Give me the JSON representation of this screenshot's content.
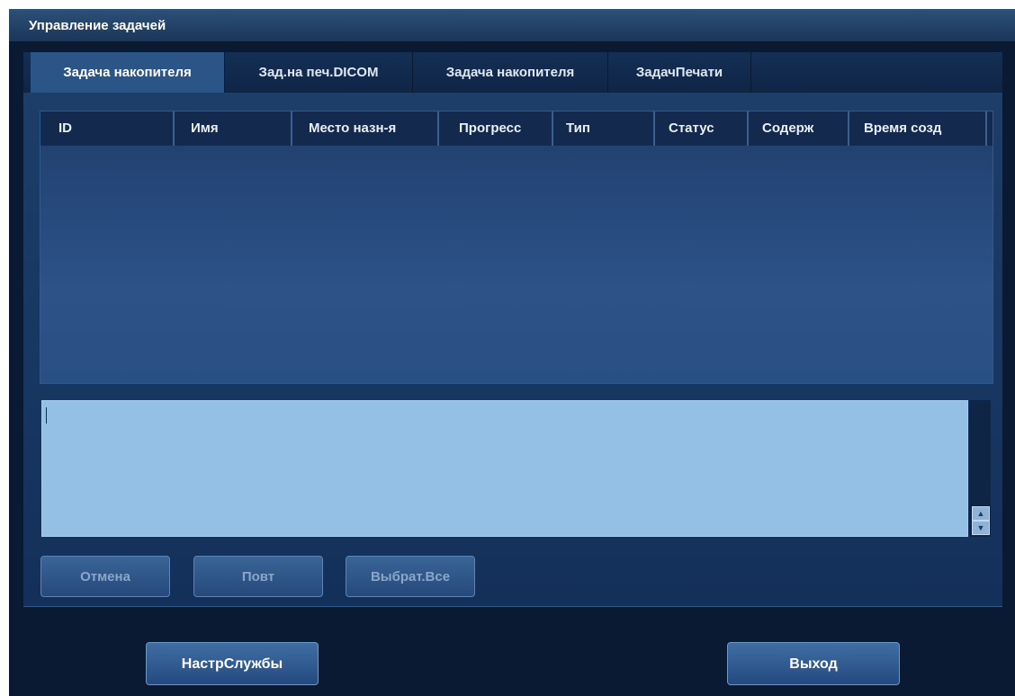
{
  "window": {
    "title": "Управление задачей"
  },
  "tabs": [
    {
      "label": "Задача накопителя",
      "active": true
    },
    {
      "label": "Зад.на печ.DICOM",
      "active": false
    },
    {
      "label": "Задача накопителя",
      "active": false
    },
    {
      "label": "ЗадачПечати",
      "active": false
    }
  ],
  "table": {
    "columns": [
      "ID",
      "Имя",
      "Место назн-я",
      "Прогресс",
      "Тип",
      "Статус",
      "Содерж",
      "Время созд"
    ],
    "rows": []
  },
  "detail": {
    "value": ""
  },
  "actions": {
    "cancel": "Отмена",
    "retry": "Повт",
    "select_all": "Выбрат.Все"
  },
  "footer": {
    "service_settings": "НастрСлужбы",
    "exit": "Выход"
  },
  "colors": {
    "background": "#0b1a33",
    "panel": "#1d3f6a",
    "detail_area": "#94c0e6",
    "active_tab": "#2b5487"
  }
}
